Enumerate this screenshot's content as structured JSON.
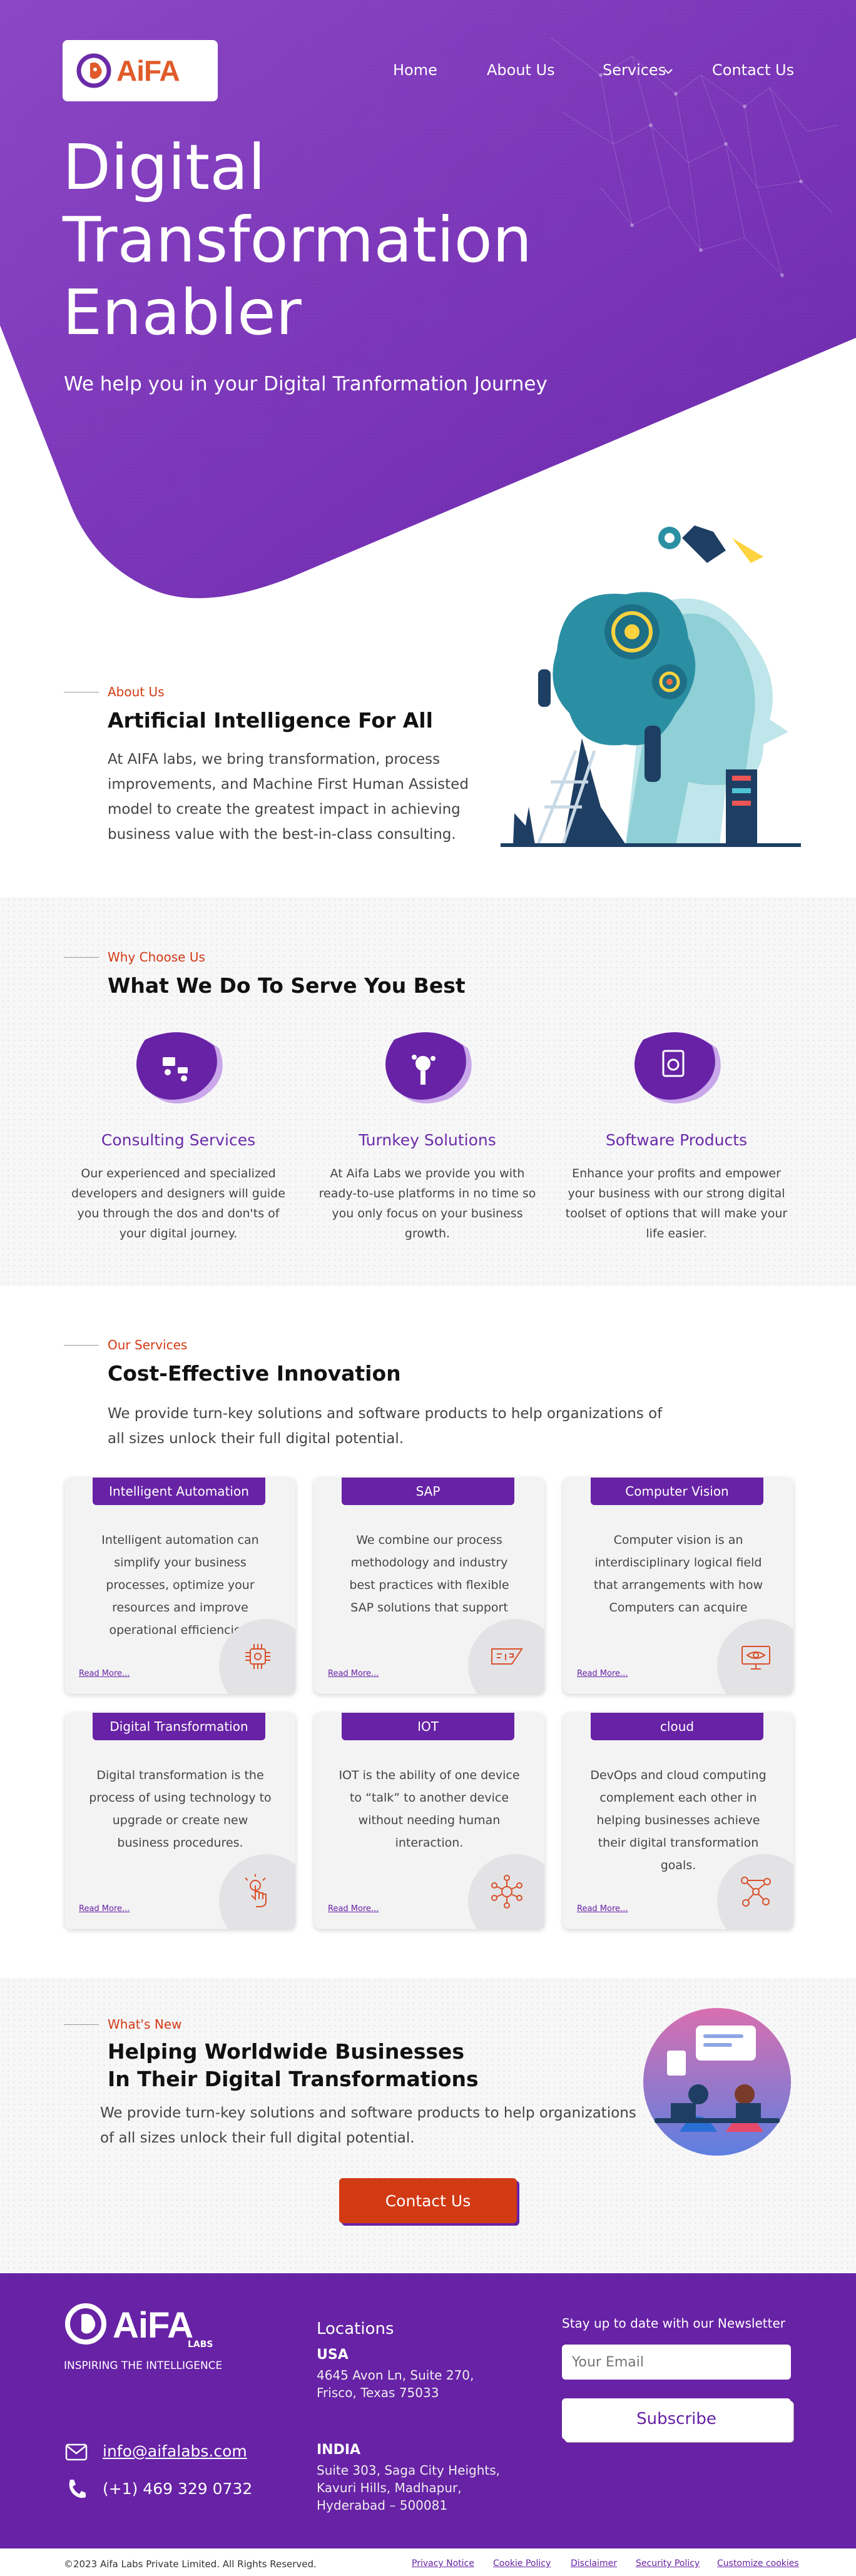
{
  "brand": {
    "name_main": "AiFA",
    "name_sub": "LABS",
    "tagline": "INSPIRING THE INTELLIGENCE",
    "accent": "#6722a5",
    "orange": "#d23a14"
  },
  "nav": {
    "home": "Home",
    "about": "About Us",
    "services": "Services",
    "contact": "Contact Us"
  },
  "hero": {
    "title": "Digital Transformation Enabler",
    "subtitle": "We help you in your Digital Tranformation Journey"
  },
  "about": {
    "eyebrow": "About Us",
    "title": "Artificial Intelligence For All",
    "body": "At AIFA labs, we bring transformation, process improvements, and Machine First Human Assisted model to create the greatest impact in achieving business value with the best-in-class consulting."
  },
  "why": {
    "eyebrow": "Why Choose Us",
    "title": "What We Do To Serve You Best",
    "features": [
      {
        "title": "Consulting Services",
        "text": "Our experienced and specialized developers and designers will guide you through the dos and don'ts of your digital journey.",
        "icon": "consulting-icon"
      },
      {
        "title": "Turnkey Solutions",
        "text": "At Aifa Labs we provide you with ready-to-use platforms in no time so you only focus on your business growth.",
        "icon": "turnkey-icon"
      },
      {
        "title": "Software Products",
        "text": "Enhance your profits and empower your business with our strong digital toolset of options that will make your life easier.",
        "icon": "software-icon"
      }
    ]
  },
  "services": {
    "eyebrow": "Our Services",
    "title": "Cost-Effective Innovation",
    "intro": "We provide turn-key solutions and software products to help organizations of all sizes unlock their full digital potential.",
    "read_more": "Read More...",
    "cards": [
      {
        "title": "Intelligent Automation",
        "text": "Intelligent automation can simplify your business processes, optimize your resources and improve operational efficiencies.",
        "icon": "chip-icon"
      },
      {
        "title": "SAP",
        "text": "We combine our process methodology and industry best practices with flexible SAP solutions that support",
        "icon": "sap-icon"
      },
      {
        "title": "Computer Vision",
        "text": "Computer vision is an interdisciplinary logical field that arrangements with how Computers can acquire",
        "icon": "monitor-eye-icon"
      },
      {
        "title": "Digital Transformation",
        "text": "Digital transformation is the process of using technology to upgrade or create new business procedures.",
        "icon": "touch-icon"
      },
      {
        "title": "IOT",
        "text": "IOT is the ability of one device to “talk” to another device without needing human interaction.",
        "icon": "iot-icon"
      },
      {
        "title": "cloud",
        "text": "DevOps and cloud computing complement each other in helping businesses achieve their digital transformation goals.",
        "icon": "cloud-network-icon"
      }
    ]
  },
  "whatsnew": {
    "eyebrow": "What's New",
    "title_line1": "Helping Worldwide Businesses",
    "title_line2": "In Their Digital Transformations",
    "body": "We provide turn-key solutions and software products to help organizations of all sizes unlock their full digital potential.",
    "button": "Contact Us"
  },
  "footer": {
    "locations_title": "Locations",
    "usa_title": "USA",
    "usa_addr1": "4645 Avon Ln, Suite 270,",
    "usa_addr2": "Frisco, Texas 75033",
    "india_title": "INDIA",
    "india_addr1": "Suite 303, Saga City Heights,",
    "india_addr2": "Kavuri Hills, Madhapur,",
    "india_addr3": "Hyderabad – 500081",
    "email": "info@aifalabs.com",
    "phone": "(+1) 469 329 0732",
    "newsletter_title": "Stay up to date with our Newsletter",
    "email_placeholder": "Your Email",
    "subscribe": "Subscribe",
    "copyright": "©2023 Aifa Labs Private Limited. All Rights Reserved.",
    "links": [
      "Privacy Notice",
      "Cookie Policy",
      "Disclaimer",
      "Security Policy",
      "Customize cookies"
    ]
  }
}
